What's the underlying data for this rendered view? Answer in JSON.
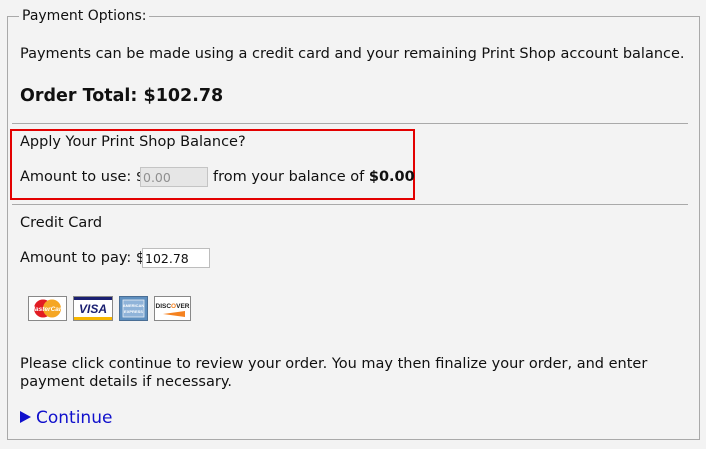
{
  "legend": "Payment Options:",
  "intro": "Payments can be made using a credit card and your remaining Print Shop account balance.",
  "order_total": "Order Total: $102.78",
  "balance": {
    "heading": "Apply Your Print Shop Balance?",
    "amount_label": "Amount to use: $",
    "amount_value": "0.00",
    "suffix": "from your balance of",
    "balance_value": "$0.00",
    "highlight_color": "#e30000"
  },
  "credit_card": {
    "heading": "Credit Card",
    "pay_label": "Amount to pay: $",
    "pay_value": "102.78",
    "cards": [
      {
        "name": "mastercard-logo",
        "text": "MasterCard"
      },
      {
        "name": "visa-logo",
        "text": "VISA"
      },
      {
        "name": "amex-logo",
        "text": "AMERICAN EXPRESS"
      },
      {
        "name": "discover-logo",
        "text": "DISCOVER"
      }
    ]
  },
  "note": "Please click continue to review your order. You may then finalize your order, and enter payment details if necessary.",
  "continue_label": "Continue",
  "link_color": "#1010cc"
}
